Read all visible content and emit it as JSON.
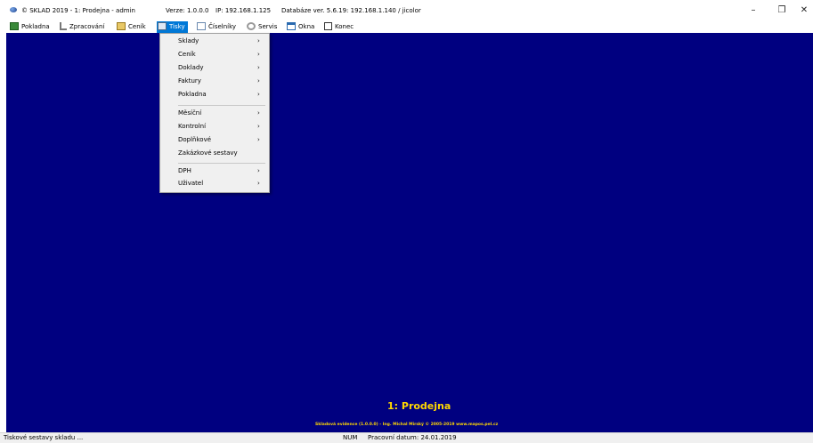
{
  "titlebar": {
    "app": "© SKLAD 2019  -  1: Prodejna  -  admin",
    "version": "Verze: 1.0.0.0",
    "ip": "IP: 192.168.1.125",
    "db": "Databáze ver. 5.6.19: 192.168.1.140 / jicolor",
    "minimize": "–",
    "restore": "❐",
    "close": "✕"
  },
  "menubar": {
    "pokladna": "Pokladna",
    "zpracovani": "Zpracování",
    "cenik": "Ceník",
    "tisky": "Tisky",
    "ciselniky": "Číselníky",
    "servis": "Servis",
    "okna": "Okna",
    "konec": "Konec"
  },
  "tisky_menu": {
    "items": [
      {
        "label": "Sklady",
        "arrow": "›"
      },
      {
        "label": "Ceník",
        "arrow": "›"
      },
      {
        "label": "Doklady",
        "arrow": "›"
      },
      {
        "label": "Faktury",
        "arrow": "›"
      },
      {
        "label": "Pokladna",
        "arrow": "›"
      },
      {
        "label": "Měsíční",
        "arrow": "›"
      },
      {
        "label": "Kontrolní",
        "arrow": "›"
      },
      {
        "label": "Doplňkové",
        "arrow": "›"
      },
      {
        "label": "Zakázkové sestavy",
        "arrow": ""
      },
      {
        "label": "DPH",
        "arrow": "›"
      },
      {
        "label": "Uživatel",
        "arrow": "›"
      }
    ]
  },
  "desktop": {
    "title": "1: Prodejna",
    "footer": "Skladová evidence (1.0.0.0) - Ing. Michal Mirský © 2005-2019  www.mapos.pel.cz"
  },
  "status": {
    "hint": "Tiskové sestavy skladu ...",
    "num": "NUM",
    "date": "Pracovní datum: 24.01.2019"
  },
  "colors": {
    "desktop": "#000080",
    "accent": "#0078d7",
    "title_text": "#ffd700"
  }
}
